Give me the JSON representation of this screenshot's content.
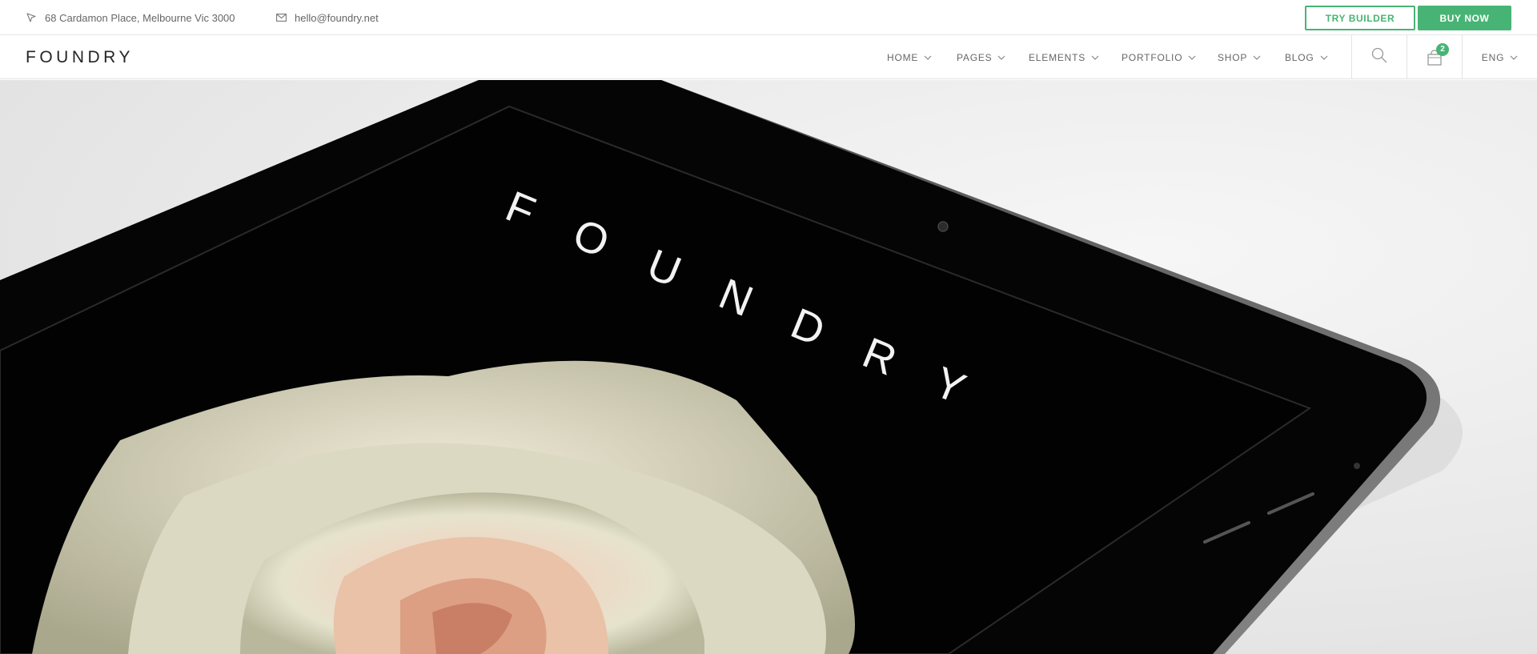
{
  "topbar": {
    "address": "68 Cardamon Place, Melbourne Vic 3000",
    "email": "hello@foundry.net",
    "try_builder_label": "TRY BUILDER",
    "buy_now_label": "BUY NOW",
    "accent_color": "#47b475"
  },
  "nav": {
    "logo": "FOUNDRY",
    "items": [
      {
        "label": "HOME"
      },
      {
        "label": "PAGES"
      },
      {
        "label": "ELEMENTS"
      },
      {
        "label": "PORTFOLIO"
      },
      {
        "label": "SHOP"
      },
      {
        "label": "BLOG"
      }
    ],
    "cart_count": "2",
    "language": "ENG"
  },
  "hero": {
    "screen_text": "FOUNDRY"
  },
  "icons": {
    "address": "pointer-icon",
    "email": "envelope-icon",
    "search": "search-icon",
    "cart": "shopping-bag-icon",
    "dropdown": "chevron-down-icon"
  }
}
